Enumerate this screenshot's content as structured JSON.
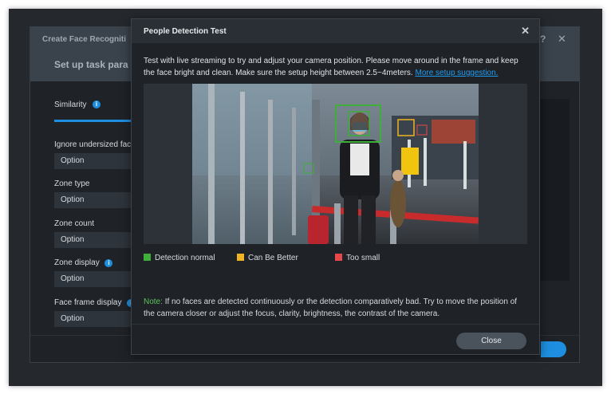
{
  "background_dialog": {
    "title": "Create Face Recogniti",
    "subtitle": "Set up task para",
    "help_label": "?",
    "close_label": "✕",
    "tab_label": "Similarity",
    "fields": [
      {
        "label": "Ignore undersized fac",
        "value": "Option",
        "info": false
      },
      {
        "label": "Zone type",
        "value": "Option",
        "info": false
      },
      {
        "label": "Zone count",
        "value": "Option",
        "info": false
      },
      {
        "label": "Zone display",
        "value": "Option",
        "info": true
      },
      {
        "label": "Face frame display",
        "value": "Option",
        "info": true
      }
    ]
  },
  "modal": {
    "title": "People Detection Test",
    "close_label": "✕",
    "description": "Test with live streaming to try and adjust your camera position. Please move around in the frame and keep the face bright and clean. Make sure the setup height between 2.5~4meters.",
    "link_text": "More setup suggestion.",
    "legend": [
      {
        "label": "Detection normal",
        "color": "#3fae3a"
      },
      {
        "label": "Can Be Better",
        "color": "#f0b323"
      },
      {
        "label": "Too small",
        "color": "#e8474b"
      }
    ],
    "note_label": "Note:",
    "note_text": "If no faces are detected continuously or the detection comparatively bad. Try to move the position of the camera closer or adjust the focus, clarity, brightness, the contrast of the camera.",
    "close_button": "Close"
  },
  "colors": {
    "accent": "#1e8fe0",
    "detection_normal": "#3fae3a",
    "can_be_better": "#f0b323",
    "too_small": "#e8474b"
  }
}
